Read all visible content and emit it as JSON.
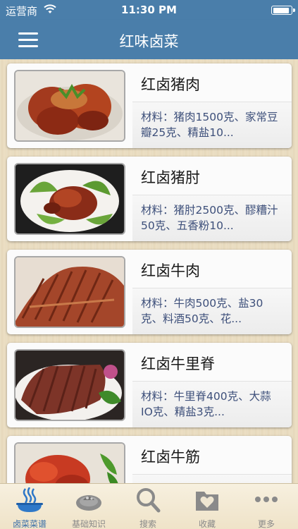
{
  "status_bar": {
    "carrier": "运营商",
    "time": "11:30 PM",
    "battery_level": 0.9
  },
  "nav": {
    "title": "红味卤菜",
    "menu_icon": "hamburger-menu-icon"
  },
  "recipes": [
    {
      "title": "红卤猪肉",
      "desc": "材料：猪肉1500克、家常豆瓣25克、精盐10..."
    },
    {
      "title": "红卤猪肘",
      "desc": "材料：猪肘2500克、醪糟汁50克、五香粉10..."
    },
    {
      "title": "红卤牛肉",
      "desc": "材料：牛肉500克、盐30克、料酒50克、花..."
    },
    {
      "title": "红卤牛里脊",
      "desc": "材料：牛里脊400克、大蒜IO克、精盐3克..."
    },
    {
      "title": "红卤牛筋",
      "desc": ""
    }
  ],
  "tabs": [
    {
      "label": "卤菜菜谱",
      "icon": "dish-icon",
      "active": true
    },
    {
      "label": "基础知识",
      "icon": "plate-icon",
      "active": false
    },
    {
      "label": "搜索",
      "icon": "search-icon",
      "active": false
    },
    {
      "label": "收藏",
      "icon": "favorites-icon",
      "active": false
    },
    {
      "label": "更多",
      "icon": "more-icon",
      "active": false
    }
  ],
  "colors": {
    "nav_bar": "#4a7eaa",
    "active_tab": "#3a6fa8",
    "description_text": "#3d4f7a"
  }
}
